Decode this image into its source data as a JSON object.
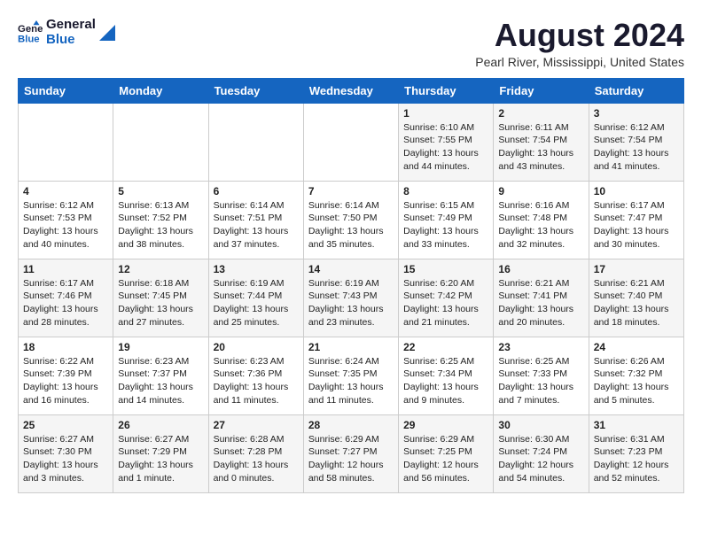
{
  "logo": {
    "line1": "General",
    "line2": "Blue"
  },
  "title": "August 2024",
  "location": "Pearl River, Mississippi, United States",
  "days_of_week": [
    "Sunday",
    "Monday",
    "Tuesday",
    "Wednesday",
    "Thursday",
    "Friday",
    "Saturday"
  ],
  "weeks": [
    [
      {
        "day": "",
        "info": ""
      },
      {
        "day": "",
        "info": ""
      },
      {
        "day": "",
        "info": ""
      },
      {
        "day": "",
        "info": ""
      },
      {
        "day": "1",
        "info": "Sunrise: 6:10 AM\nSunset: 7:55 PM\nDaylight: 13 hours\nand 44 minutes."
      },
      {
        "day": "2",
        "info": "Sunrise: 6:11 AM\nSunset: 7:54 PM\nDaylight: 13 hours\nand 43 minutes."
      },
      {
        "day": "3",
        "info": "Sunrise: 6:12 AM\nSunset: 7:54 PM\nDaylight: 13 hours\nand 41 minutes."
      }
    ],
    [
      {
        "day": "4",
        "info": "Sunrise: 6:12 AM\nSunset: 7:53 PM\nDaylight: 13 hours\nand 40 minutes."
      },
      {
        "day": "5",
        "info": "Sunrise: 6:13 AM\nSunset: 7:52 PM\nDaylight: 13 hours\nand 38 minutes."
      },
      {
        "day": "6",
        "info": "Sunrise: 6:14 AM\nSunset: 7:51 PM\nDaylight: 13 hours\nand 37 minutes."
      },
      {
        "day": "7",
        "info": "Sunrise: 6:14 AM\nSunset: 7:50 PM\nDaylight: 13 hours\nand 35 minutes."
      },
      {
        "day": "8",
        "info": "Sunrise: 6:15 AM\nSunset: 7:49 PM\nDaylight: 13 hours\nand 33 minutes."
      },
      {
        "day": "9",
        "info": "Sunrise: 6:16 AM\nSunset: 7:48 PM\nDaylight: 13 hours\nand 32 minutes."
      },
      {
        "day": "10",
        "info": "Sunrise: 6:17 AM\nSunset: 7:47 PM\nDaylight: 13 hours\nand 30 minutes."
      }
    ],
    [
      {
        "day": "11",
        "info": "Sunrise: 6:17 AM\nSunset: 7:46 PM\nDaylight: 13 hours\nand 28 minutes."
      },
      {
        "day": "12",
        "info": "Sunrise: 6:18 AM\nSunset: 7:45 PM\nDaylight: 13 hours\nand 27 minutes."
      },
      {
        "day": "13",
        "info": "Sunrise: 6:19 AM\nSunset: 7:44 PM\nDaylight: 13 hours\nand 25 minutes."
      },
      {
        "day": "14",
        "info": "Sunrise: 6:19 AM\nSunset: 7:43 PM\nDaylight: 13 hours\nand 23 minutes."
      },
      {
        "day": "15",
        "info": "Sunrise: 6:20 AM\nSunset: 7:42 PM\nDaylight: 13 hours\nand 21 minutes."
      },
      {
        "day": "16",
        "info": "Sunrise: 6:21 AM\nSunset: 7:41 PM\nDaylight: 13 hours\nand 20 minutes."
      },
      {
        "day": "17",
        "info": "Sunrise: 6:21 AM\nSunset: 7:40 PM\nDaylight: 13 hours\nand 18 minutes."
      }
    ],
    [
      {
        "day": "18",
        "info": "Sunrise: 6:22 AM\nSunset: 7:39 PM\nDaylight: 13 hours\nand 16 minutes."
      },
      {
        "day": "19",
        "info": "Sunrise: 6:23 AM\nSunset: 7:37 PM\nDaylight: 13 hours\nand 14 minutes."
      },
      {
        "day": "20",
        "info": "Sunrise: 6:23 AM\nSunset: 7:36 PM\nDaylight: 13 hours\nand 11 minutes."
      },
      {
        "day": "21",
        "info": "Sunrise: 6:24 AM\nSunset: 7:35 PM\nDaylight: 13 hours\nand 11 minutes."
      },
      {
        "day": "22",
        "info": "Sunrise: 6:25 AM\nSunset: 7:34 PM\nDaylight: 13 hours\nand 9 minutes."
      },
      {
        "day": "23",
        "info": "Sunrise: 6:25 AM\nSunset: 7:33 PM\nDaylight: 13 hours\nand 7 minutes."
      },
      {
        "day": "24",
        "info": "Sunrise: 6:26 AM\nSunset: 7:32 PM\nDaylight: 13 hours\nand 5 minutes."
      }
    ],
    [
      {
        "day": "25",
        "info": "Sunrise: 6:27 AM\nSunset: 7:30 PM\nDaylight: 13 hours\nand 3 minutes."
      },
      {
        "day": "26",
        "info": "Sunrise: 6:27 AM\nSunset: 7:29 PM\nDaylight: 13 hours\nand 1 minute."
      },
      {
        "day": "27",
        "info": "Sunrise: 6:28 AM\nSunset: 7:28 PM\nDaylight: 13 hours\nand 0 minutes."
      },
      {
        "day": "28",
        "info": "Sunrise: 6:29 AM\nSunset: 7:27 PM\nDaylight: 12 hours\nand 58 minutes."
      },
      {
        "day": "29",
        "info": "Sunrise: 6:29 AM\nSunset: 7:25 PM\nDaylight: 12 hours\nand 56 minutes."
      },
      {
        "day": "30",
        "info": "Sunrise: 6:30 AM\nSunset: 7:24 PM\nDaylight: 12 hours\nand 54 minutes."
      },
      {
        "day": "31",
        "info": "Sunrise: 6:31 AM\nSunset: 7:23 PM\nDaylight: 12 hours\nand 52 minutes."
      }
    ]
  ]
}
